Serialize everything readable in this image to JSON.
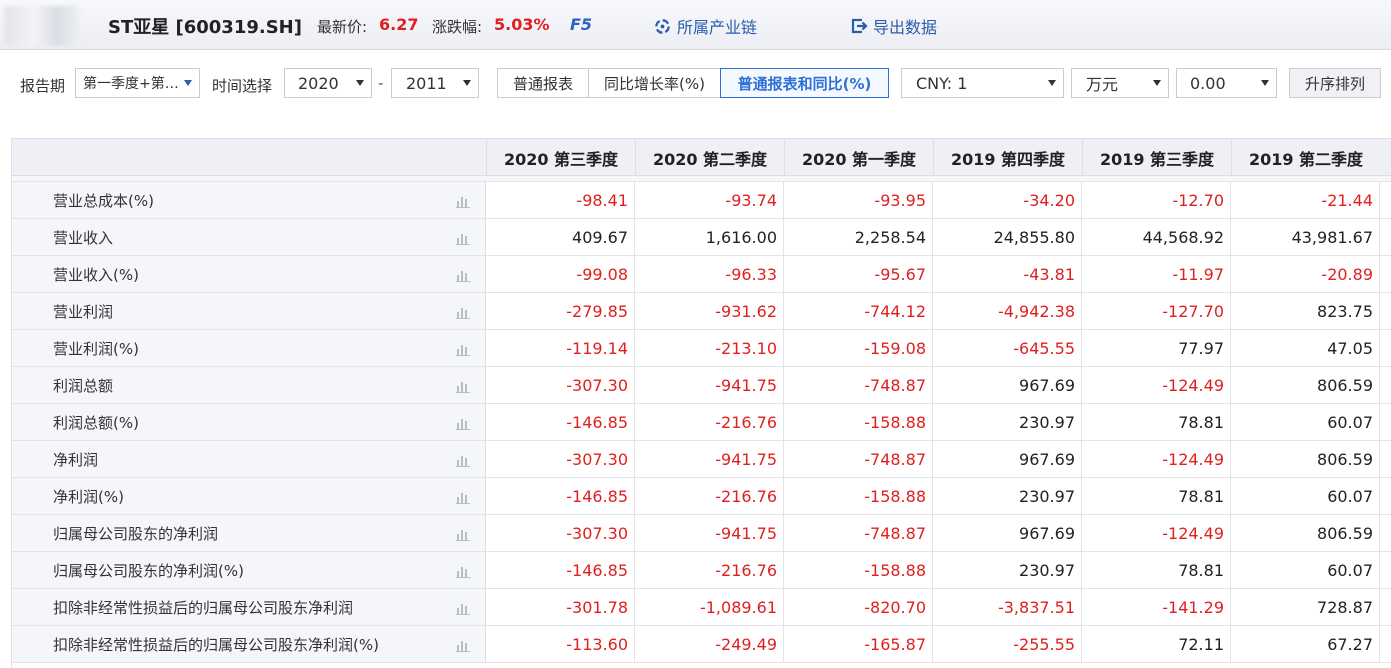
{
  "header": {
    "stock_title": "ST亚星 [600319.SH]",
    "price_label": "最新价:",
    "price_value": "6.27",
    "change_label": "涨跌幅:",
    "change_value": "5.03%",
    "f5_label": "F5",
    "industry_chain_label": "所属产业链",
    "export_label": "导出数据"
  },
  "toolbar": {
    "report_period_label": "报告期",
    "report_period_value": "第一季度+第…",
    "time_select_label": "时间选择",
    "year_from": "2020",
    "year_separator": "-",
    "year_to": "2011",
    "segments": [
      "普通报表",
      "同比增长率(%)",
      "普通报表和同比(%)"
    ],
    "active_segment": "普通报表和同比(%)",
    "currency": "CNY: 1",
    "unit": "万元",
    "decimals": "0.00",
    "sort_label": "升序排列"
  },
  "table": {
    "columns": [
      "2020 第三季度",
      "2020 第二季度",
      "2020 第一季度",
      "2019 第四季度",
      "2019 第三季度",
      "2019 第二季度"
    ],
    "rows": [
      {
        "name": "营业总成本(%)",
        "values": [
          "-98.41",
          "-93.74",
          "-93.95",
          "-34.20",
          "-12.70",
          "-21.44"
        ]
      },
      {
        "name": "营业收入",
        "values": [
          "409.67",
          "1,616.00",
          "2,258.54",
          "24,855.80",
          "44,568.92",
          "43,981.67"
        ]
      },
      {
        "name": "营业收入(%)",
        "values": [
          "-99.08",
          "-96.33",
          "-95.67",
          "-43.81",
          "-11.97",
          "-20.89"
        ]
      },
      {
        "name": "营业利润",
        "values": [
          "-279.85",
          "-931.62",
          "-744.12",
          "-4,942.38",
          "-127.70",
          "823.75"
        ]
      },
      {
        "name": "营业利润(%)",
        "values": [
          "-119.14",
          "-213.10",
          "-159.08",
          "-645.55",
          "77.97",
          "47.05"
        ]
      },
      {
        "name": "利润总额",
        "values": [
          "-307.30",
          "-941.75",
          "-748.87",
          "967.69",
          "-124.49",
          "806.59"
        ]
      },
      {
        "name": "利润总额(%)",
        "values": [
          "-146.85",
          "-216.76",
          "-158.88",
          "230.97",
          "78.81",
          "60.07"
        ]
      },
      {
        "name": "净利润",
        "values": [
          "-307.30",
          "-941.75",
          "-748.87",
          "967.69",
          "-124.49",
          "806.59"
        ]
      },
      {
        "name": "净利润(%)",
        "values": [
          "-146.85",
          "-216.76",
          "-158.88",
          "230.97",
          "78.81",
          "60.07"
        ]
      },
      {
        "name": "归属母公司股东的净利润",
        "values": [
          "-307.30",
          "-941.75",
          "-748.87",
          "967.69",
          "-124.49",
          "806.59"
        ]
      },
      {
        "name": "归属母公司股东的净利润(%)",
        "values": [
          "-146.85",
          "-216.76",
          "-158.88",
          "230.97",
          "78.81",
          "60.07"
        ]
      },
      {
        "name": "扣除非经常性损益后的归属母公司股东净利润",
        "values": [
          "-301.78",
          "-1,089.61",
          "-820.70",
          "-3,837.51",
          "-141.29",
          "728.87"
        ]
      },
      {
        "name": "扣除非经常性损益后的归属母公司股东净利润(%)",
        "values": [
          "-113.60",
          "-249.49",
          "-165.87",
          "-255.55",
          "72.11",
          "67.27"
        ]
      }
    ]
  },
  "colors": {
    "negative": "#e02020",
    "positive": "#222222",
    "accent": "#2f6fd6",
    "link": "#2b5cae"
  }
}
